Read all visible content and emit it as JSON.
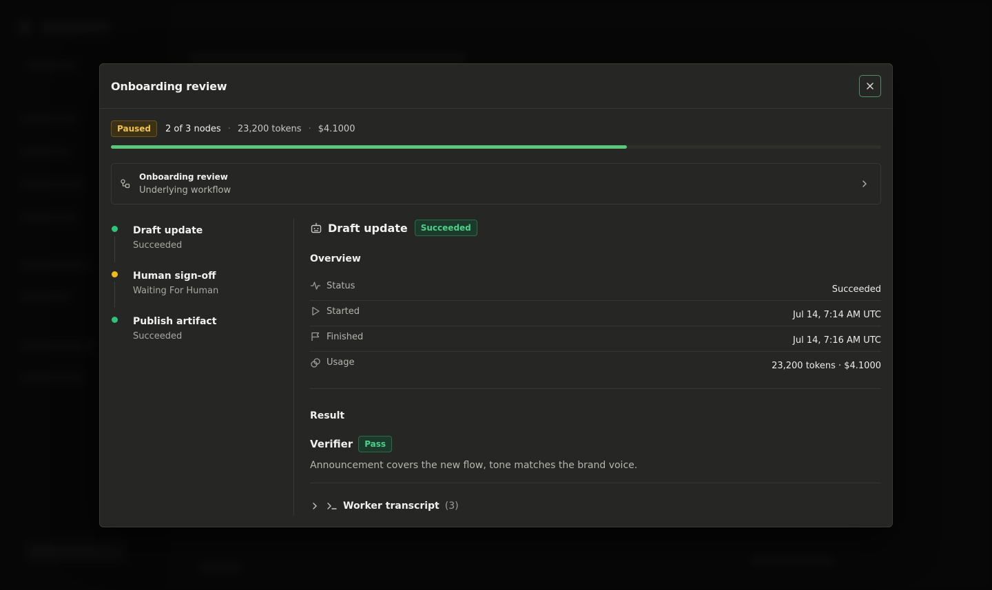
{
  "modal": {
    "title": "Onboarding review",
    "close_icon": "close-icon"
  },
  "summary": {
    "status_badge": "Paused",
    "nodes": "2 of 3 nodes",
    "tokens": "23,200 tokens",
    "cost": "$4.1000",
    "separator": "·",
    "progress_fraction": 0.67
  },
  "workflow_card": {
    "title": "Onboarding review",
    "subtitle": "Underlying workflow",
    "icon": "workflow-icon"
  },
  "timeline": {
    "steps": [
      {
        "name": "Draft update",
        "status": "Succeeded",
        "color": "#2fc27a"
      },
      {
        "name": "Human sign-off",
        "status": "Waiting For Human",
        "color": "#f2b91a"
      },
      {
        "name": "Publish artifact",
        "status": "Succeeded",
        "color": "#2fc27a"
      }
    ]
  },
  "detail": {
    "title": "Draft update",
    "badge": "Succeeded",
    "icon": "bot-icon",
    "overview_title": "Overview",
    "overview": [
      {
        "label": "Status",
        "value": "Succeeded",
        "icon": "activity-icon"
      },
      {
        "label": "Started",
        "value": "Jul 14, 7:14 AM UTC",
        "icon": "play-icon"
      },
      {
        "label": "Finished",
        "value": "Jul 14, 7:16 AM UTC",
        "icon": "flag-icon"
      },
      {
        "label": "Usage",
        "value": "23,200 tokens · $4.1000",
        "icon": "coins-icon"
      }
    ],
    "result_title": "Result",
    "verifier_label": "Verifier",
    "verifier_badge": "Pass",
    "result_text": "Announcement covers the new flow, tone matches the brand voice.",
    "transcript_label": "Worker transcript",
    "transcript_count": "(3)"
  },
  "colors": {
    "accent_green": "#5cc77a",
    "paused_yellow": "#f0c44a"
  }
}
